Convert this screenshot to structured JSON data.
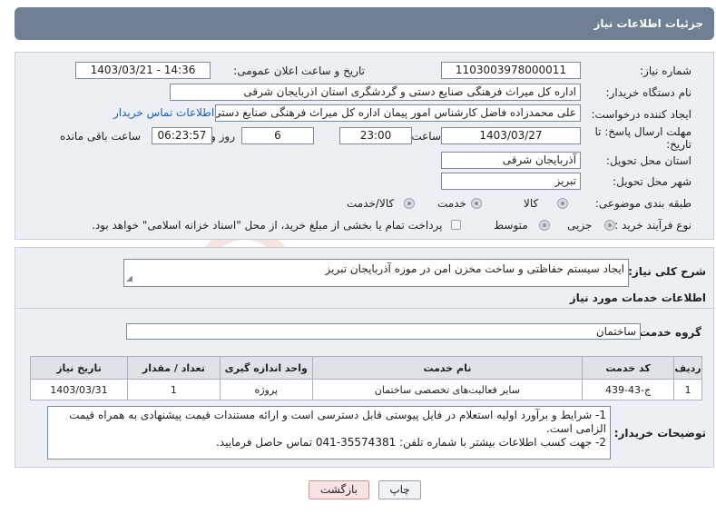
{
  "header": {
    "title": "جزئیات اطلاعات نیاز"
  },
  "form": {
    "need_number_label": "شماره نیاز:",
    "need_number": "1103003978000011",
    "announce_label": "تاریخ و ساعت اعلان عمومی:",
    "announce_value": "1403/03/21 - 14:36",
    "buyer_org_label": "نام دستگاه خریدار:",
    "buyer_org": "اداره کل میراث فرهنگی  صنایع دستی و گردشگری استان اذربایجان شرقی",
    "creator_label": "ایجاد کننده درخواست:",
    "creator": "علی محمدزاده فاضل کارشناس امور پیمان اداره کل میراث فرهنگی  صنایع دستی",
    "contact_link": "اطلاعات تماس خریدار",
    "deadline_label_1": "مهلت ارسال پاسخ: تا",
    "deadline_label_2": "تاریخ:",
    "deadline_date": "1403/03/27",
    "time_label": "ساعت",
    "deadline_time": "23:00",
    "days_value": "6",
    "days_label": "روز و",
    "remaining_time": "06:23:57",
    "remaining_label": "ساعت باقی مانده",
    "province_label": "استان محل تحویل:",
    "province": "آذربایجان شرقی",
    "city_label": "شهر محل تحویل:",
    "city": "تبریز",
    "category_label": "طبقه بندی موضوعی:",
    "category_options": [
      "کالا",
      "خدمت",
      "کالا/خدمت"
    ],
    "category_selected": "خدمت",
    "process_label": "نوع فرآیند خرید :",
    "process_options": [
      "جزیی",
      "متوسط"
    ],
    "process_selected": "متوسط",
    "payment_note": "پرداخت تمام یا بخشی از مبلغ خرید، از محل \"اسناد خزانه اسلامی\" خواهد بود."
  },
  "details": {
    "summary_label": "شرح کلی نیاز:",
    "summary": "ایجاد سیستم حفاظتی و ساخت مخزن امن در موزه آذربایجان تبریز",
    "services_heading": "اطلاعات خدمات مورد نیاز",
    "service_group_label": "گروه خدمت:",
    "service_group": "ساختمان",
    "table": {
      "headers": [
        "ردیف",
        "کد خدمت",
        "نام خدمت",
        "واحد اندازه گیری",
        "تعداد / مقدار",
        "تاریخ نیاز"
      ],
      "rows": [
        [
          "1",
          "ج-43-439",
          "سایر فعالیت‌های تخصصی ساختمان",
          "پروژه",
          "1",
          "1403/03/31"
        ]
      ]
    },
    "buyer_notes_label": "توضیحات خریدار:",
    "buyer_notes": [
      "1- شرایط و برآورد اولیه استعلام در فایل پیوستی قابل دسترسی است و ارائه مستندات قیمت پیشنهادی به همراه قیمت الزامی است.",
      "2- جهت کسب اطلاعات بیشتر  با شماره تلفن: 35574381-041  تماس حاصل فرمایید."
    ]
  },
  "buttons": {
    "print": "چاپ",
    "back": "بازگشت"
  },
  "watermark": {
    "text": "AriaTender.neT"
  },
  "colors": {
    "header": "#6f7f94",
    "panel": "#ecf0f4",
    "link": "#1a5fb4",
    "back_button": "#fbe3e3"
  }
}
